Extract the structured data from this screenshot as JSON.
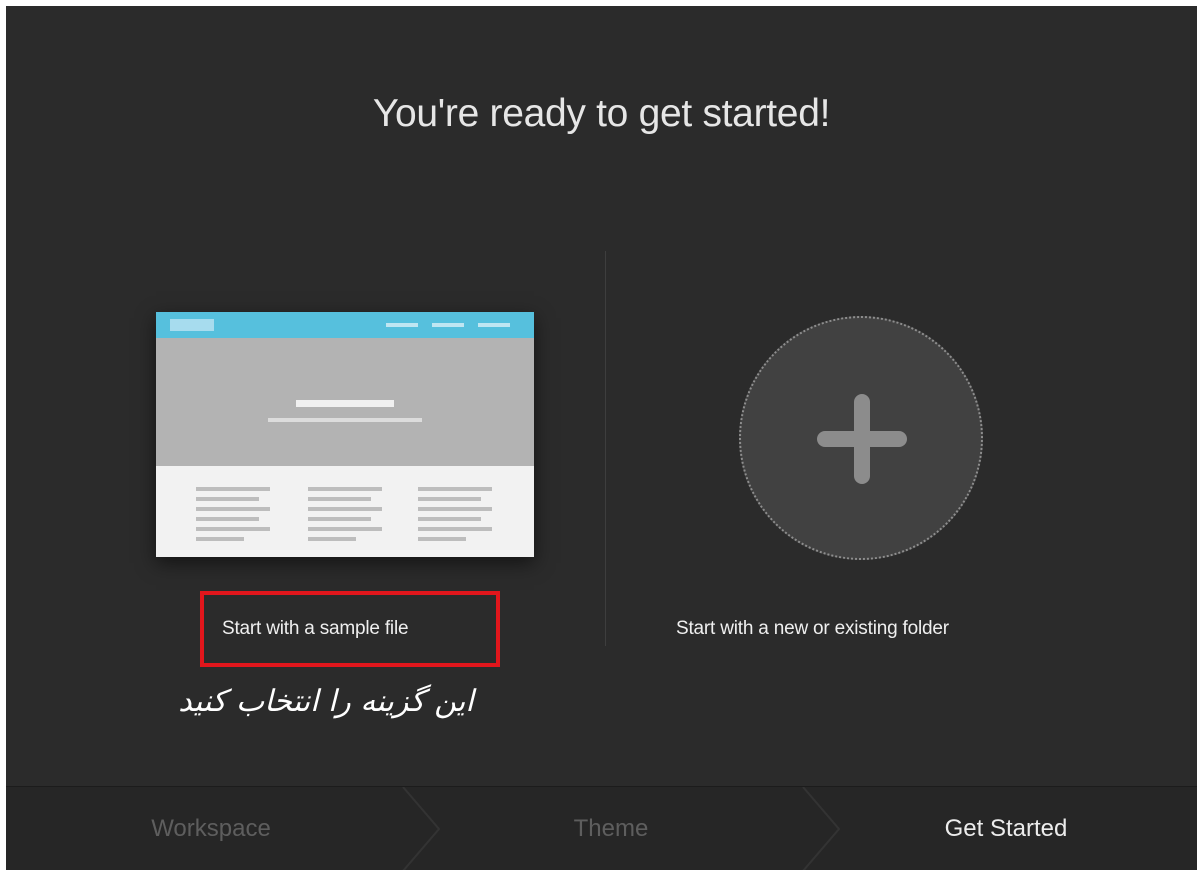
{
  "page": {
    "title": "You're ready to get started!"
  },
  "options": {
    "sample": {
      "label": "Start with a sample file",
      "annotation": "این گزینه را انتخاب کنید"
    },
    "folder": {
      "label": "Start with a new or existing folder",
      "icon": "plus-icon"
    }
  },
  "steps": [
    {
      "label": "Workspace",
      "state": "inactive"
    },
    {
      "label": "Theme",
      "state": "inactive"
    },
    {
      "label": "Get Started",
      "state": "active"
    }
  ],
  "colors": {
    "background": "#2b2b2b",
    "thumbnail_header": "#56c0dd",
    "highlight_box": "#e1161c"
  }
}
